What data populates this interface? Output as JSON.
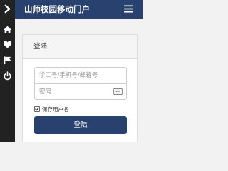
{
  "header": {
    "title": "山师校园移动门户",
    "menu_icon": "hamburger-menu-icon"
  },
  "sidebar": {
    "items": [
      {
        "icon": "chevron-right-icon"
      },
      {
        "icon": "home-icon"
      },
      {
        "icon": "heart-icon"
      },
      {
        "icon": "flag-icon"
      },
      {
        "icon": "power-icon"
      }
    ]
  },
  "login": {
    "heading": "登陆",
    "username_placeholder": "学工号/手机号/邮箱号",
    "password_placeholder": "密码",
    "remember_label": "保存用户名",
    "remember_checked": true,
    "submit_label": "登陆",
    "keyboard_icon": "keyboard-icon"
  },
  "colors": {
    "brand": "#28416e",
    "sidebar": "#222222",
    "page_background": "#f2f2f2"
  }
}
